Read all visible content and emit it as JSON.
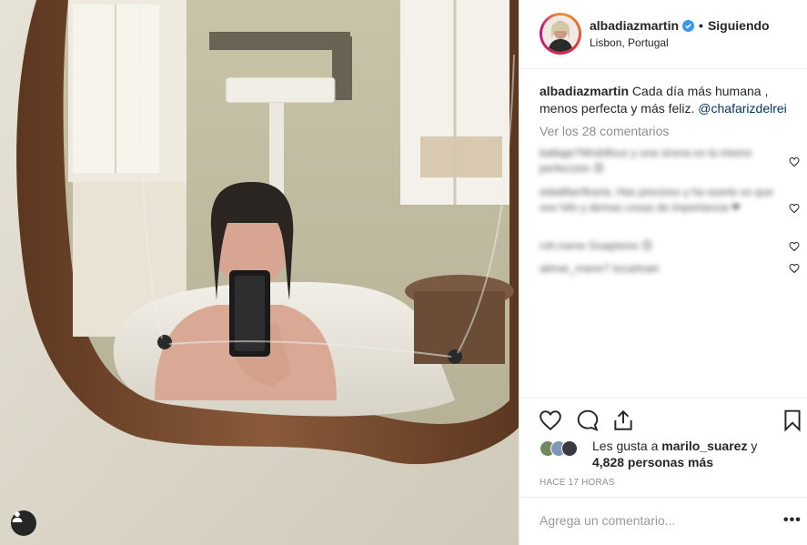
{
  "post": {
    "image_alt": "Mirror selfie in bathtub",
    "colors": {
      "wall": "#d9d4c6",
      "frame": "#7a4a2e",
      "accent": "#3897f0"
    }
  },
  "header": {
    "username": "albadiazmartin",
    "verified": true,
    "separator": "•",
    "follow_status": "Siguiendo",
    "location": "Lisbon, Portugal"
  },
  "caption": {
    "username": "albadiazmartin",
    "text": "Cada día más humana , menos perfecta y más feliz.",
    "mention": "@chafarizdelrei"
  },
  "view_comments": "Ver los 28 comentarios",
  "comments": [
    {
      "text": "ballage7Mrsb9sus y una sirena es la mismo perfección 😍"
    },
    {
      "text": "elda8farrftraria. Has precioso y ha suerte so que ese hifo y demas cosas de importancia ❤"
    },
    {
      "text": "roh.mene Guapismo 😍"
    },
    {
      "text": "alimar_marer7 tocartrael"
    }
  ],
  "actions": {
    "icons": [
      "heart-icon",
      "comment-icon",
      "share-icon",
      "bookmark-icon"
    ]
  },
  "likes": {
    "prefix": "Les gusta a",
    "user": "marilo_suarez",
    "conj": "y",
    "count_text": "4,828 personas más"
  },
  "timestamp": "HACE 17 HORAS",
  "comment_box": {
    "placeholder": "Agrega un comentario...",
    "more": "•••"
  }
}
